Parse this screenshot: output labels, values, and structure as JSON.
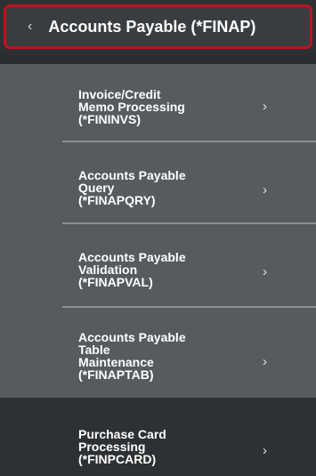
{
  "header": {
    "back_icon": "chevron-left-icon",
    "title": "Accounts Payable (*FINAP)"
  },
  "menu": {
    "items": [
      {
        "label": "Invoice/Credit\nMemo Processing\n(*FININVS)",
        "chevron": "›"
      },
      {
        "label": "Accounts Payable\nQuery\n(*FINAPQRY)",
        "chevron": "›"
      },
      {
        "label": "Accounts Payable\nValidation\n(*FINAPVAL)",
        "chevron": "›"
      },
      {
        "label": "Accounts Payable\nTable\nMaintenance\n(*FINAPTAB)",
        "chevron": "›"
      },
      {
        "label": "Purchase Card\nProcessing\n(*FINPCARD)",
        "chevron": "›"
      }
    ]
  },
  "glyphs": {
    "back": "‹"
  },
  "colors": {
    "highlight_border": "#c0111f",
    "menu_background": "#565b5f",
    "dark_background": "#2e3133",
    "text": "#ffffff"
  }
}
